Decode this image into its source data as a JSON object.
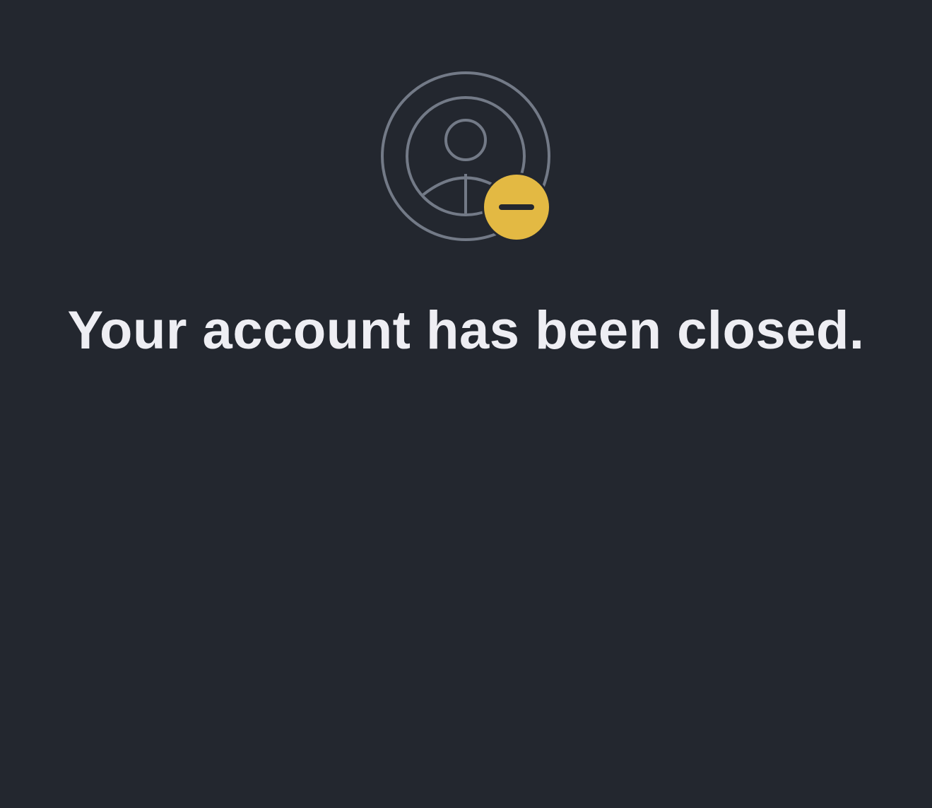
{
  "status": {
    "title": "Your account has been closed.",
    "icon": "account-closed-icon",
    "badge_icon": "minus-icon"
  },
  "colors": {
    "background": "#23272f",
    "title_text": "#eeeef3",
    "icon_stroke": "#737a87",
    "badge_fill": "#e3b943",
    "badge_minus": "#23272f"
  }
}
